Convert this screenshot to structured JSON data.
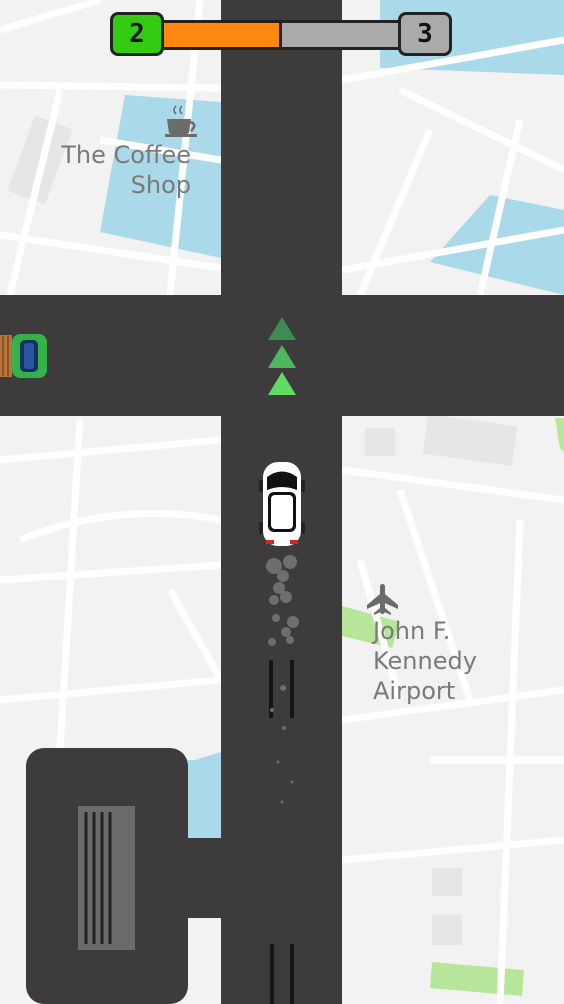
{
  "hud": {
    "current_level": "2",
    "next_level": "3",
    "level_progress": 0.5,
    "colors": {
      "current": "#33cc11",
      "next": "#aaaaaa",
      "fill": "#ff8811"
    }
  },
  "map": {
    "places": [
      {
        "name": "The Coffee\nShop",
        "icon": "coffee-cup-icon"
      },
      {
        "name": "John F.\nKennedy\nAirport",
        "icon": "airplane-icon"
      }
    ],
    "colors": {
      "road": "#3d3b3c",
      "ground": "#f2f2f2",
      "streets": "#ffffff",
      "water": "#aad9ea",
      "park": "#b7e69a",
      "block": "#e6e6e6"
    }
  },
  "player": {
    "car": "white-car",
    "direction_arrows": 3
  },
  "traffic": [
    {
      "type": "green-truck"
    }
  ]
}
